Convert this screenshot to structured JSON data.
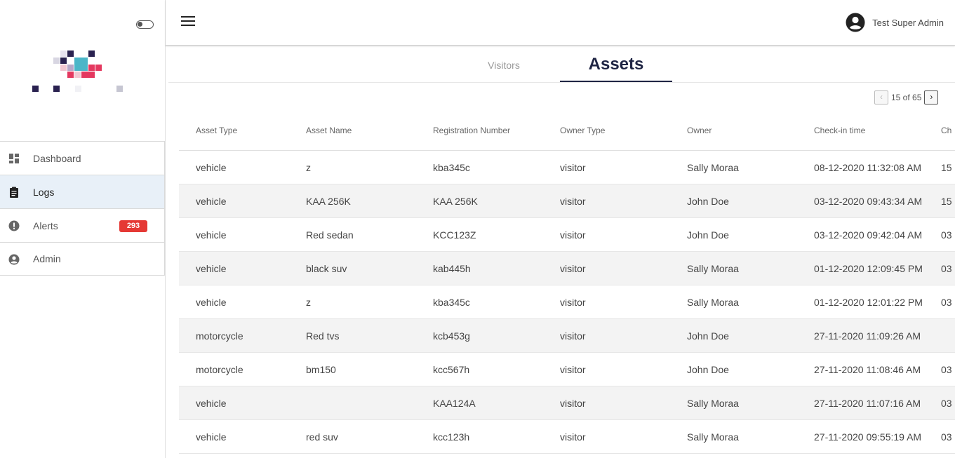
{
  "user": {
    "name": "Test Super Admin"
  },
  "sidebar": {
    "items": [
      {
        "label": "Dashboard",
        "icon": "dashboard-icon"
      },
      {
        "label": "Logs",
        "icon": "clipboard-icon",
        "active": true
      },
      {
        "label": "Alerts",
        "icon": "alert-icon",
        "badge": "293"
      },
      {
        "label": "Admin",
        "icon": "account-icon"
      }
    ]
  },
  "tabs": {
    "visitors": "Visitors",
    "assets": "Assets"
  },
  "pagination": {
    "prev": "‹",
    "text": "15 of 65",
    "next": "›"
  },
  "table": {
    "columns": [
      "Asset Type",
      "Asset Name",
      "Registration Number",
      "Owner Type",
      "Owner",
      "Check-in time",
      "Ch"
    ],
    "rows": [
      [
        "vehicle",
        "z",
        "kba345c",
        "visitor",
        "Sally Moraa",
        "08-12-2020 11:32:08 AM",
        "15"
      ],
      [
        "vehicle",
        "KAA 256K",
        "KAA 256K",
        "visitor",
        "John Doe",
        "03-12-2020 09:43:34 AM",
        "15"
      ],
      [
        "vehicle",
        "Red sedan",
        "KCC123Z",
        "visitor",
        "John Doe",
        "03-12-2020 09:42:04 AM",
        "03"
      ],
      [
        "vehicle",
        "black suv",
        "kab445h",
        "visitor",
        "Sally Moraa",
        "01-12-2020 12:09:45 PM",
        "03"
      ],
      [
        "vehicle",
        "z",
        "kba345c",
        "visitor",
        "Sally Moraa",
        "01-12-2020 12:01:22 PM",
        "03"
      ],
      [
        "motorcycle",
        "Red tvs",
        "kcb453g",
        "visitor",
        "John Doe",
        "27-11-2020 11:09:26 AM",
        ""
      ],
      [
        "motorcycle",
        "bm150",
        "kcc567h",
        "visitor",
        "John Doe",
        "27-11-2020 11:08:46 AM",
        "03"
      ],
      [
        "vehicle",
        "",
        "KAA124A",
        "visitor",
        "Sally Moraa",
        "27-11-2020 11:07:16 AM",
        "03"
      ],
      [
        "vehicle",
        "red suv",
        "kcc123h",
        "visitor",
        "Sally Moraa",
        "27-11-2020 09:55:19 AM",
        "03"
      ]
    ]
  },
  "colors": {
    "accent": "#1f2544",
    "badge": "#e53935",
    "active_nav": "#e8f0f8"
  }
}
